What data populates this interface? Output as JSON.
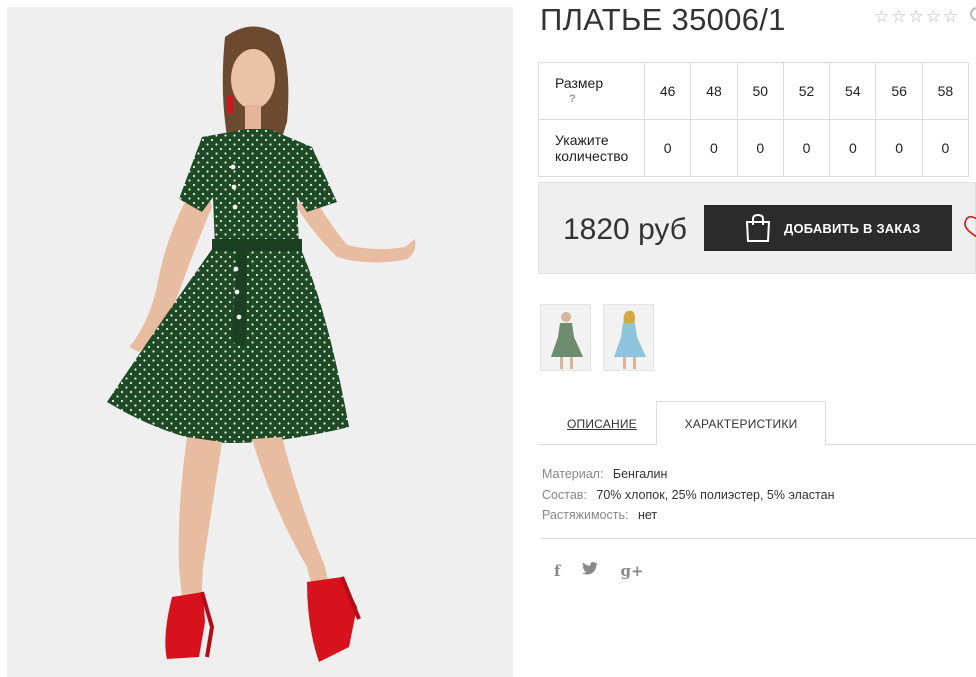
{
  "product": {
    "title": "ПЛАТЬЕ 35006/1",
    "rating_stars": [
      "☆",
      "☆",
      "☆",
      "☆",
      "☆"
    ]
  },
  "size_table": {
    "size_label": "Размер",
    "help_mark": "?",
    "quantity_label": "Укажите количество",
    "sizes": [
      "46",
      "48",
      "50",
      "52",
      "54",
      "56",
      "58"
    ],
    "quantities": [
      "0",
      "0",
      "0",
      "0",
      "0",
      "0",
      "0"
    ]
  },
  "buy": {
    "price": "1820 руб",
    "add_button": "ДОБАВИТЬ В ЗАКАЗ",
    "icon": "shopping-bag-icon",
    "wishlist_icon": "heart-icon"
  },
  "thumbnails": [
    {
      "name": "green-dress-thumbnail",
      "color": "#4e7a53"
    },
    {
      "name": "blue-dress-thumbnail",
      "color": "#8ec4dc"
    }
  ],
  "tabs": {
    "description": "ОПИСАНИЕ",
    "characteristics": "ХАРАКТЕРИСТИКИ",
    "active": "characteristics"
  },
  "specs": [
    {
      "key": "Материал:",
      "value": "Бенгалин"
    },
    {
      "key": "Состав:",
      "value": "70% хлопок, 25% полиэстер, 5% эластан"
    },
    {
      "key": "Растяжимость:",
      "value": "нет"
    }
  ],
  "social": {
    "facebook": "f",
    "twitter": "twitter-icon",
    "googleplus": "g+"
  },
  "colors": {
    "dress": "#1f4a26",
    "shoes": "#d8121c",
    "button": "#2b2b2b",
    "buybox_bg": "#efefef"
  }
}
